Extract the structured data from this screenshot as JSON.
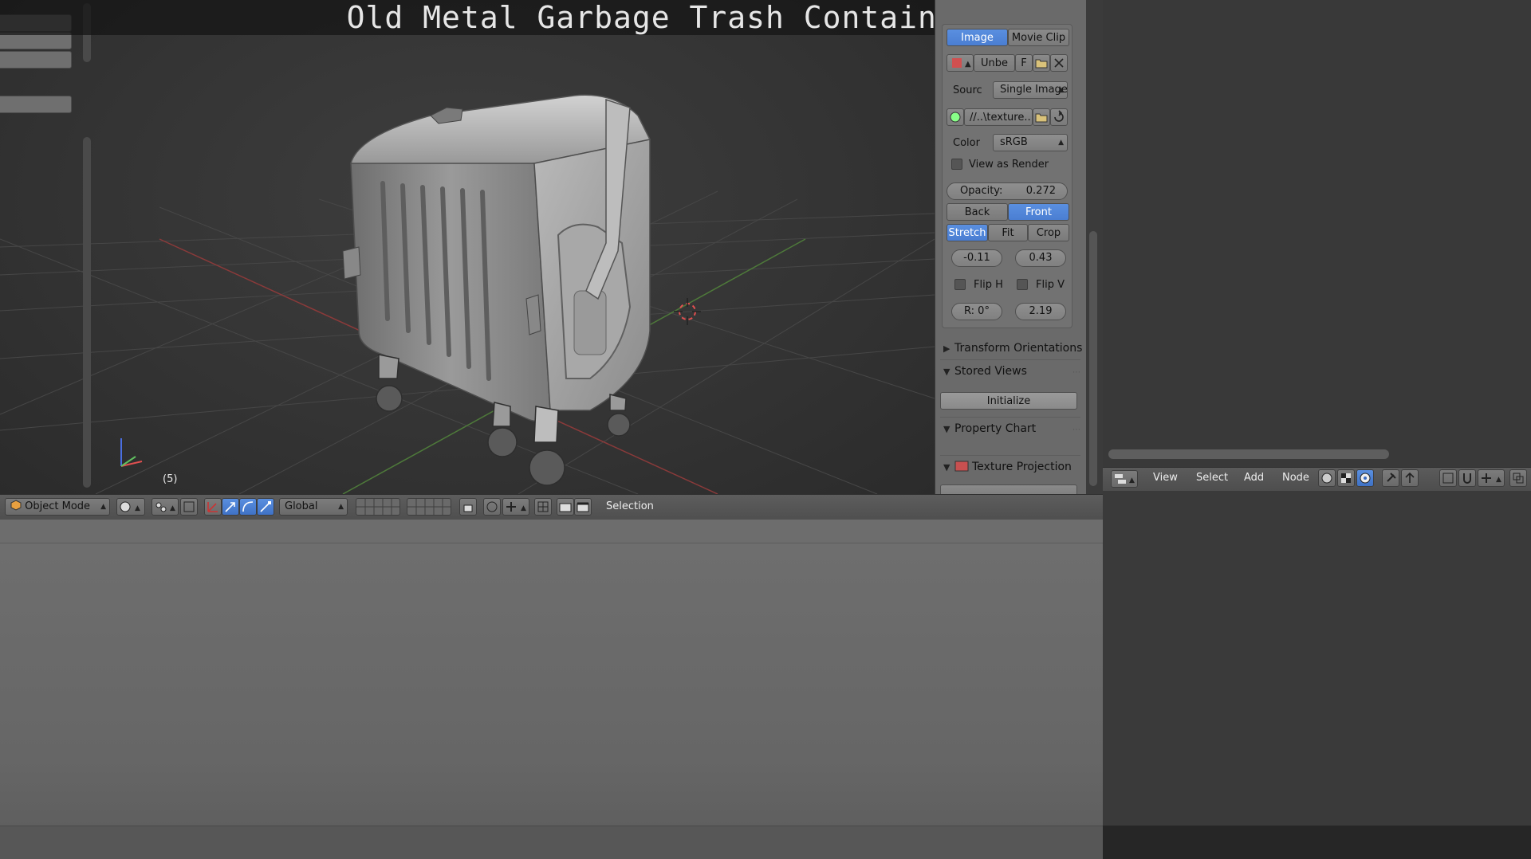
{
  "title": "Old Metal Garbage Trash Container (Low-Poly)",
  "viewport": {
    "frame_label": "(5)"
  },
  "panel": {
    "tabs": [
      "Image",
      "Movie Clip"
    ],
    "image_name": "Unbe",
    "fake_user": "F",
    "source_label": "Sourc",
    "source_value": "Single Image",
    "filepath": "//..\\texture...",
    "color_label": "Color",
    "color_value": "sRGB",
    "view_as_render": "View as Render",
    "opacity_label": "Opacity:",
    "opacity_value": "0.272",
    "back": "Back",
    "front": "Front",
    "stretch": "Stretch",
    "fit": "Fit",
    "crop": "Crop",
    "offset_x": "-0.11",
    "offset_y": "0.43",
    "flip_h": "Flip H",
    "flip_v": "Flip V",
    "rotation": "R: 0°",
    "size": "2.19",
    "transform_orientations": "Transform Orientations",
    "stored_views": "Stored Views",
    "initialize": "Initialize",
    "property_chart": "Property Chart",
    "texture_projection": "Texture Projection"
  },
  "header3d": {
    "mode": "Object Mode",
    "orientation": "Global",
    "selection": "Selection"
  },
  "node_editor": {
    "menus": [
      "View",
      "Select",
      "Add",
      "Node"
    ]
  }
}
